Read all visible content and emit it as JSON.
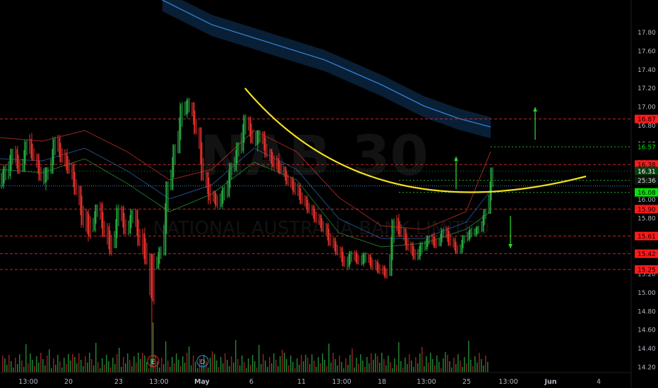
{
  "watermark": {
    "symbol": "NAB",
    "interval": "30",
    "company": "NATIONAL AUSTRALIA BANK LIMITED"
  },
  "colors": {
    "background": "#000000",
    "candle_up": "#26a641",
    "candle_down": "#e0302a",
    "price_tag_up": "#00e600",
    "price_tag_down": "#ff1a1a",
    "ma_long": "#2f7fd0",
    "ma_long_band": "#0b2540",
    "arc": "#f5e01e",
    "level_red": "#e0302a",
    "level_green": "#2fd02f",
    "current_price_line": "#2a8fd8",
    "volume_up": "#1f7a2e",
    "volume_down": "#8a1f1f",
    "axis_text": "#b2b5be"
  },
  "chart_data": {
    "type": "candlestick",
    "title": "",
    "y_axis": {
      "ticks": [
        "17.80",
        "17.60",
        "17.40",
        "17.20",
        "17.00",
        "16.80",
        "16.60",
        "16.40",
        "16.20",
        "16.00",
        "15.80",
        "15.60",
        "15.40",
        "15.20",
        "15.00",
        "14.80",
        "14.60",
        "14.40",
        "14.20"
      ],
      "range": [
        14.15,
        17.82
      ]
    },
    "x_axis": {
      "ticks": [
        "13:00",
        "20",
        "23",
        "13:00",
        "May",
        "6",
        "11",
        "13:00",
        "18",
        "13:00",
        "25",
        "13:00",
        "Jun",
        "4"
      ],
      "bar_range": [
        0,
        120
      ]
    },
    "price_levels": [
      {
        "label": "16.87",
        "value": 16.87,
        "color": "red",
        "style": "dashed"
      },
      {
        "label": "16.57",
        "value": 16.57,
        "color": "green",
        "style": "dotted"
      },
      {
        "label": "16.38",
        "value": 16.38,
        "color": "red",
        "style": "dashed"
      },
      {
        "label": "16.21",
        "value": 16.21,
        "color": "green",
        "style": "dotted"
      },
      {
        "label": "16.08",
        "value": 16.08,
        "color": "green",
        "style": "dotted"
      },
      {
        "label": "15.90",
        "value": 15.9,
        "color": "red",
        "style": "dashed"
      },
      {
        "label": "15.61",
        "value": 15.61,
        "color": "red",
        "style": "dashed"
      },
      {
        "label": "15.42",
        "value": 15.42,
        "color": "red",
        "style": "dashed"
      },
      {
        "label": "15.25",
        "value": 15.25,
        "color": "red",
        "style": "dashed"
      }
    ],
    "last_price": {
      "label": "16.31",
      "value": 16.31,
      "countdown": "25:36"
    },
    "candles_ohlc": [
      [
        16.2,
        16.38,
        16.12,
        16.3
      ],
      [
        16.3,
        16.55,
        16.22,
        16.5
      ],
      [
        16.5,
        16.58,
        16.28,
        16.32
      ],
      [
        16.32,
        16.65,
        16.3,
        16.6
      ],
      [
        16.6,
        16.72,
        16.42,
        16.45
      ],
      [
        16.45,
        16.5,
        16.2,
        16.25
      ],
      [
        16.25,
        16.35,
        16.1,
        16.3
      ],
      [
        16.3,
        16.68,
        16.28,
        16.62
      ],
      [
        16.62,
        16.7,
        16.4,
        16.45
      ],
      [
        16.45,
        16.55,
        16.28,
        16.34
      ],
      [
        16.34,
        16.4,
        16.05,
        16.1
      ],
      [
        16.1,
        16.15,
        15.7,
        15.78
      ],
      [
        15.78,
        15.9,
        15.55,
        15.7
      ],
      [
        15.7,
        15.95,
        15.65,
        15.92
      ],
      [
        15.92,
        15.98,
        15.6,
        15.64
      ],
      [
        15.64,
        15.75,
        15.4,
        15.5
      ],
      [
        15.5,
        15.95,
        15.48,
        15.88
      ],
      [
        15.88,
        15.94,
        15.62,
        15.68
      ],
      [
        15.68,
        15.9,
        15.62,
        15.85
      ],
      [
        15.85,
        15.9,
        15.5,
        15.55
      ],
      [
        15.55,
        15.7,
        15.3,
        15.4
      ],
      [
        15.4,
        15.42,
        14.2,
        15.3
      ],
      [
        15.3,
        15.5,
        15.25,
        15.45
      ],
      [
        15.45,
        16.2,
        15.4,
        16.15
      ],
      [
        16.15,
        16.6,
        16.1,
        16.55
      ],
      [
        16.55,
        17.05,
        16.5,
        16.98
      ],
      [
        16.98,
        17.1,
        16.88,
        17.02
      ],
      [
        17.02,
        17.05,
        16.7,
        16.75
      ],
      [
        16.75,
        16.78,
        16.2,
        16.25
      ],
      [
        16.25,
        16.3,
        15.95,
        16.05
      ],
      [
        16.05,
        16.1,
        15.9,
        15.98
      ],
      [
        15.98,
        16.15,
        15.9,
        16.08
      ],
      [
        16.08,
        16.4,
        16.02,
        16.35
      ],
      [
        16.35,
        16.62,
        16.3,
        16.58
      ],
      [
        16.58,
        16.92,
        16.5,
        16.85
      ],
      [
        16.85,
        16.9,
        16.6,
        16.65
      ],
      [
        16.65,
        16.75,
        16.52,
        16.7
      ],
      [
        16.7,
        16.74,
        16.45,
        16.5
      ],
      [
        16.5,
        16.55,
        16.32,
        16.4
      ],
      [
        16.4,
        16.5,
        16.28,
        16.32
      ],
      [
        16.32,
        16.36,
        16.15,
        16.2
      ],
      [
        16.2,
        16.25,
        16.05,
        16.12
      ],
      [
        16.12,
        16.18,
        15.95,
        16.0
      ],
      [
        16.0,
        16.05,
        15.85,
        15.9
      ],
      [
        15.9,
        15.95,
        15.75,
        15.8
      ],
      [
        15.8,
        15.85,
        15.65,
        15.7
      ],
      [
        15.7,
        15.75,
        15.5,
        15.55
      ],
      [
        15.55,
        15.6,
        15.4,
        15.45
      ],
      [
        15.45,
        15.5,
        15.28,
        15.32
      ],
      [
        15.32,
        15.45,
        15.25,
        15.4
      ],
      [
        15.4,
        15.46,
        15.3,
        15.35
      ],
      [
        15.35,
        15.44,
        15.28,
        15.38
      ],
      [
        15.38,
        15.42,
        15.25,
        15.3
      ],
      [
        15.3,
        15.36,
        15.2,
        15.25
      ],
      [
        15.25,
        15.3,
        15.15,
        15.2
      ],
      [
        15.2,
        15.8,
        15.18,
        15.75
      ],
      [
        15.75,
        15.85,
        15.6,
        15.65
      ],
      [
        15.65,
        15.7,
        15.45,
        15.5
      ],
      [
        15.5,
        15.55,
        15.35,
        15.4
      ],
      [
        15.4,
        15.55,
        15.35,
        15.5
      ],
      [
        15.5,
        15.62,
        15.45,
        15.58
      ],
      [
        15.58,
        15.65,
        15.48,
        15.52
      ],
      [
        15.52,
        15.7,
        15.5,
        15.66
      ],
      [
        15.66,
        15.72,
        15.5,
        15.55
      ],
      [
        15.55,
        15.6,
        15.42,
        15.45
      ],
      [
        15.45,
        15.62,
        15.42,
        15.6
      ],
      [
        15.6,
        15.7,
        15.55,
        15.65
      ],
      [
        15.65,
        15.72,
        15.6,
        15.68
      ],
      [
        15.68,
        15.9,
        15.65,
        15.88
      ],
      [
        15.88,
        16.35,
        15.85,
        16.31
      ]
    ]
  }
}
